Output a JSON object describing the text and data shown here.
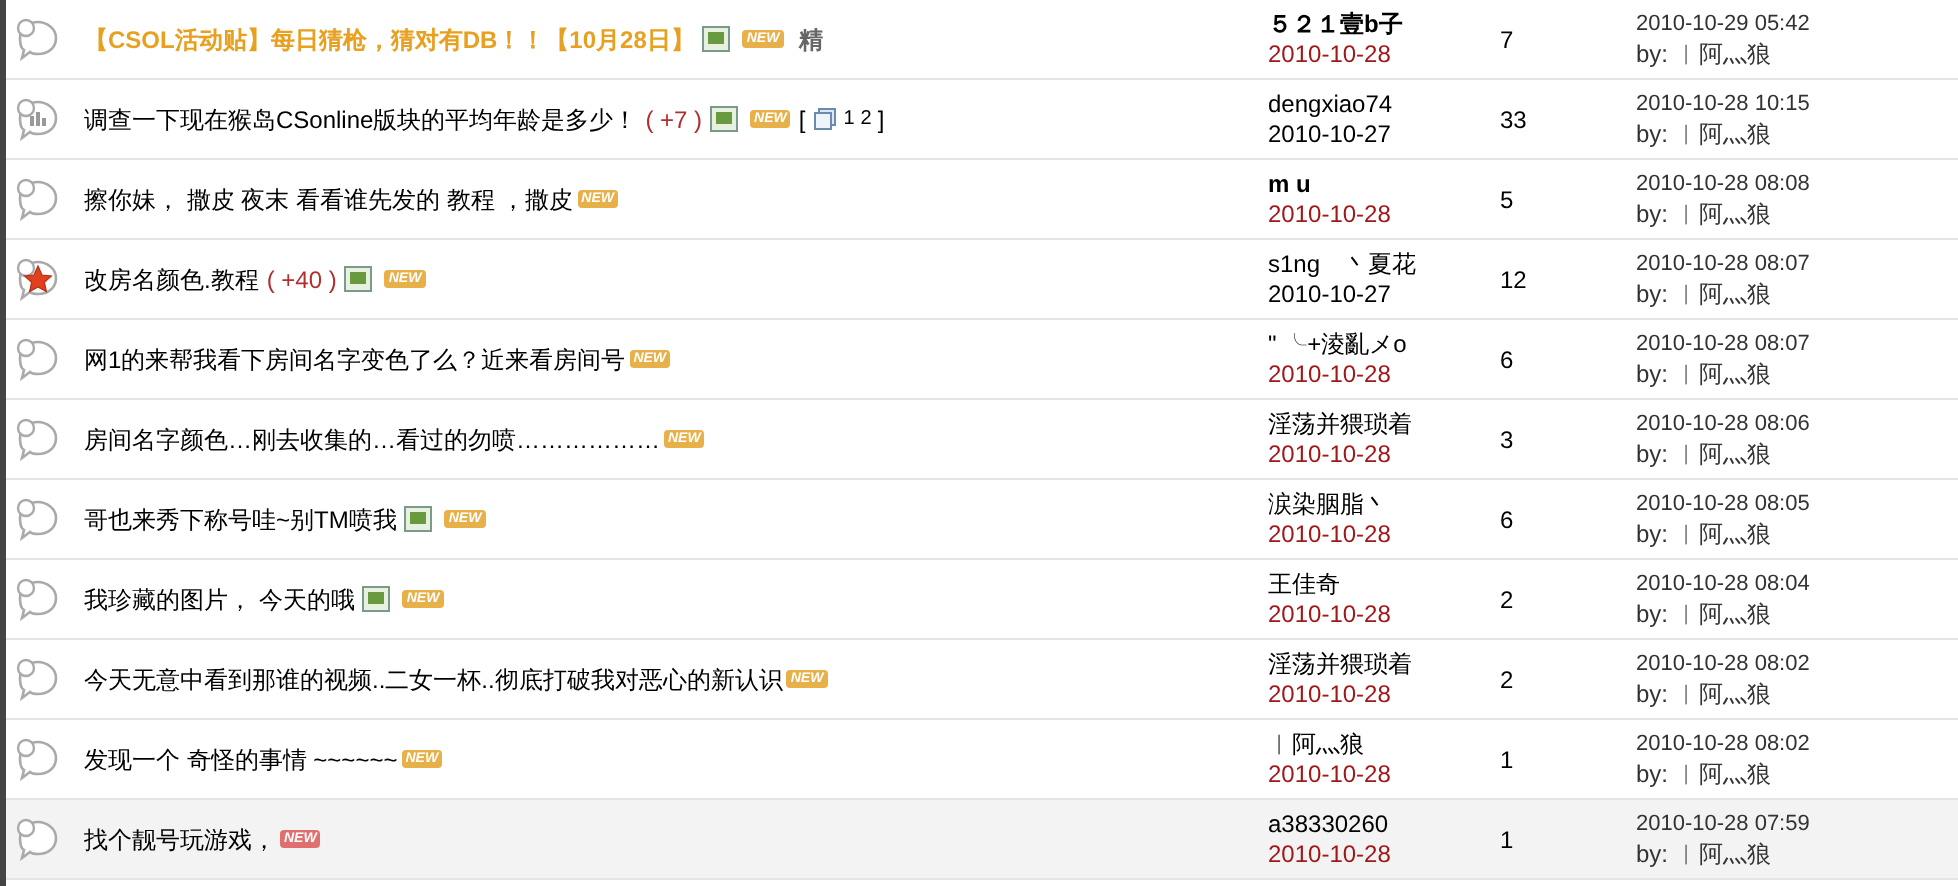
{
  "threads": [
    {
      "kind": "normal",
      "title": "【CSOL活动贴】每日猜枪，猜对有DB！！【10月28日】",
      "highlight": true,
      "has_image": true,
      "new_badge": {
        "text": "NEW",
        "color": "#e8b048"
      },
      "digest": "精",
      "author": "５２１壹b子",
      "author_bold": true,
      "post_date": "2010-10-28",
      "date_new": true,
      "replies": "7",
      "last_post": "2010-10-29 05:42",
      "last_by": "by: ︱阿灬狼",
      "highlighted": false
    },
    {
      "kind": "poll",
      "title": "调查一下现在猴岛CSonline版块的平均年龄是多少！",
      "highlight": false,
      "rating": "( +7 )",
      "has_image": true,
      "new_badge": {
        "text": "NEW",
        "color": "#e8b048"
      },
      "pages": {
        "open": "[",
        "links": [
          "1",
          "2"
        ],
        "close": "]"
      },
      "author": "dengxiao74",
      "author_bold": false,
      "post_date": "2010-10-27",
      "date_new": false,
      "replies": "33",
      "last_post": "2010-10-28 10:15",
      "last_by": "by: ︱阿灬狼",
      "highlighted": false
    },
    {
      "kind": "normal",
      "title": "擦你妹， 撒皮 夜末 看看谁先发的 教程 ，撒皮",
      "highlight": false,
      "has_image": false,
      "new_badge": {
        "text": "NEW",
        "color": "#e8b048"
      },
      "author": "m u",
      "author_bold": true,
      "post_date": "2010-10-28",
      "date_new": true,
      "replies": "5",
      "last_post": "2010-10-28 08:08",
      "last_by": "by: ︱阿灬狼",
      "highlighted": false
    },
    {
      "kind": "hot",
      "title": "改房名颜色.教程",
      "highlight": false,
      "rating": "( +40 )",
      "has_image": true,
      "new_badge": {
        "text": "NEW",
        "color": "#e8b048"
      },
      "author": "s1ng　丶夏花",
      "author_bold": false,
      "post_date": "2010-10-27",
      "date_new": false,
      "replies": "12",
      "last_post": "2010-10-28 08:07",
      "last_by": "by: ︱阿灬狼",
      "highlighted": false
    },
    {
      "kind": "normal",
      "title": "网1的来帮我看下房间名字变色了么？近来看房间号",
      "highlight": false,
      "has_image": false,
      "new_badge": {
        "text": "NEW",
        "color": "#e8b048"
      },
      "author": "\" ╰+淩亂メo",
      "author_bold": false,
      "post_date": "2010-10-28",
      "date_new": true,
      "replies": "6",
      "last_post": "2010-10-28 08:07",
      "last_by": "by: ︱阿灬狼",
      "highlighted": false
    },
    {
      "kind": "normal",
      "title": "房间名字颜色…刚去收集的…看过的勿喷………………",
      "highlight": false,
      "has_image": false,
      "new_badge": {
        "text": "NEW",
        "color": "#e8b048"
      },
      "author": "淫荡并猥琐着",
      "author_bold": false,
      "post_date": "2010-10-28",
      "date_new": true,
      "replies": "3",
      "last_post": "2010-10-28 08:06",
      "last_by": "by: ︱阿灬狼",
      "highlighted": false
    },
    {
      "kind": "normal",
      "title": "哥也来秀下称号哇~别TM喷我",
      "highlight": false,
      "has_image": true,
      "new_badge": {
        "text": "NEW",
        "color": "#e8b048"
      },
      "author": "涙染胭脂丶",
      "author_bold": false,
      "post_date": "2010-10-28",
      "date_new": true,
      "replies": "6",
      "last_post": "2010-10-28 08:05",
      "last_by": "by: ︱阿灬狼",
      "highlighted": false
    },
    {
      "kind": "normal",
      "title": "我珍藏的图片， 今天的哦",
      "highlight": false,
      "has_image": true,
      "new_badge": {
        "text": "NEW",
        "color": "#e8b048"
      },
      "author": "王佳奇",
      "author_bold": false,
      "post_date": "2010-10-28",
      "date_new": true,
      "replies": "2",
      "last_post": "2010-10-28 08:04",
      "last_by": "by: ︱阿灬狼",
      "highlighted": false
    },
    {
      "kind": "normal",
      "title": "今天无意中看到那谁的视频..二女一杯..彻底打破我对恶心的新认识",
      "highlight": false,
      "has_image": false,
      "new_badge": {
        "text": "NEW",
        "color": "#e8b048"
      },
      "author": "淫荡并猥琐着",
      "author_bold": false,
      "post_date": "2010-10-28",
      "date_new": true,
      "replies": "2",
      "last_post": "2010-10-28 08:02",
      "last_by": "by: ︱阿灬狼",
      "highlighted": false
    },
    {
      "kind": "normal",
      "title": "发现一个  奇怪的事情    ~~~~~~",
      "highlight": false,
      "has_image": false,
      "new_badge": {
        "text": "NEW",
        "color": "#e8b048"
      },
      "author": "︱阿灬狼",
      "author_bold": false,
      "post_date": "2010-10-28",
      "date_new": true,
      "replies": "1",
      "last_post": "2010-10-28 08:02",
      "last_by": "by: ︱阿灬狼",
      "highlighted": false
    },
    {
      "kind": "normal",
      "title": "找个靓号玩游戏，",
      "highlight": false,
      "has_image": false,
      "new_badge": {
        "text": "NEW",
        "color": "#e07070"
      },
      "author": "a38330260",
      "author_bold": false,
      "post_date": "2010-10-28",
      "date_new": true,
      "replies": "1",
      "last_post": "2010-10-28 07:59",
      "last_by": "by: ︱阿灬狼",
      "highlighted": true
    }
  ]
}
